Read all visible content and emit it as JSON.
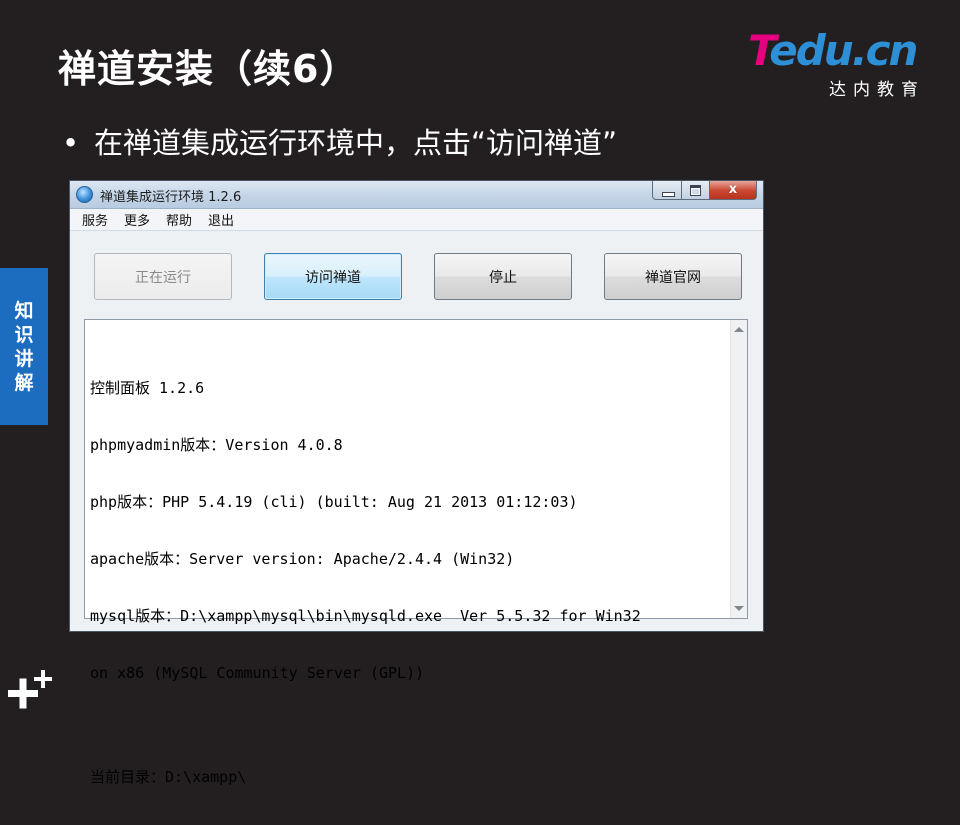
{
  "slide": {
    "title": "禅道安装（续6）",
    "bullet": "在禅道集成运行环境中，点击“访问禅道”",
    "bullet_marker": "•",
    "side_tab": [
      "知",
      "识",
      "讲",
      "解"
    ],
    "colors": {
      "background": "#231f20",
      "side_tab": "#1c6cbf",
      "logo_pink": "#e4007f",
      "logo_blue": "#2d8fd6"
    }
  },
  "logo": {
    "t": "T",
    "rest": "edu.cn",
    "subtitle": "达内教育"
  },
  "window": {
    "title": "禅道集成运行环境 1.2.6",
    "app_icon": "globe-icon",
    "controls": {
      "close_glyph": "x"
    },
    "menu": [
      "服务",
      "更多",
      "帮助",
      "退出"
    ],
    "buttons": {
      "running": "正在运行",
      "visit": "访问禅道",
      "stop": "停止",
      "official": "禅道官网"
    },
    "log": [
      "控制面板 1.2.6",
      "phpmyadmin版本：Version 4.0.8",
      "php版本：PHP 5.4.19 (cli) (built: Aug 21 2013 01:12:03)",
      "apache版本：Server version: Apache/2.4.4 (Win32)",
      "mysql版本：D:\\xampp\\mysql\\bin\\mysqld.exe  Ver 5.5.32 for Win32",
      "on x86 (MySQL Community Server (GPL))",
      "",
      "当前目录：D:\\xampp\\"
    ]
  }
}
